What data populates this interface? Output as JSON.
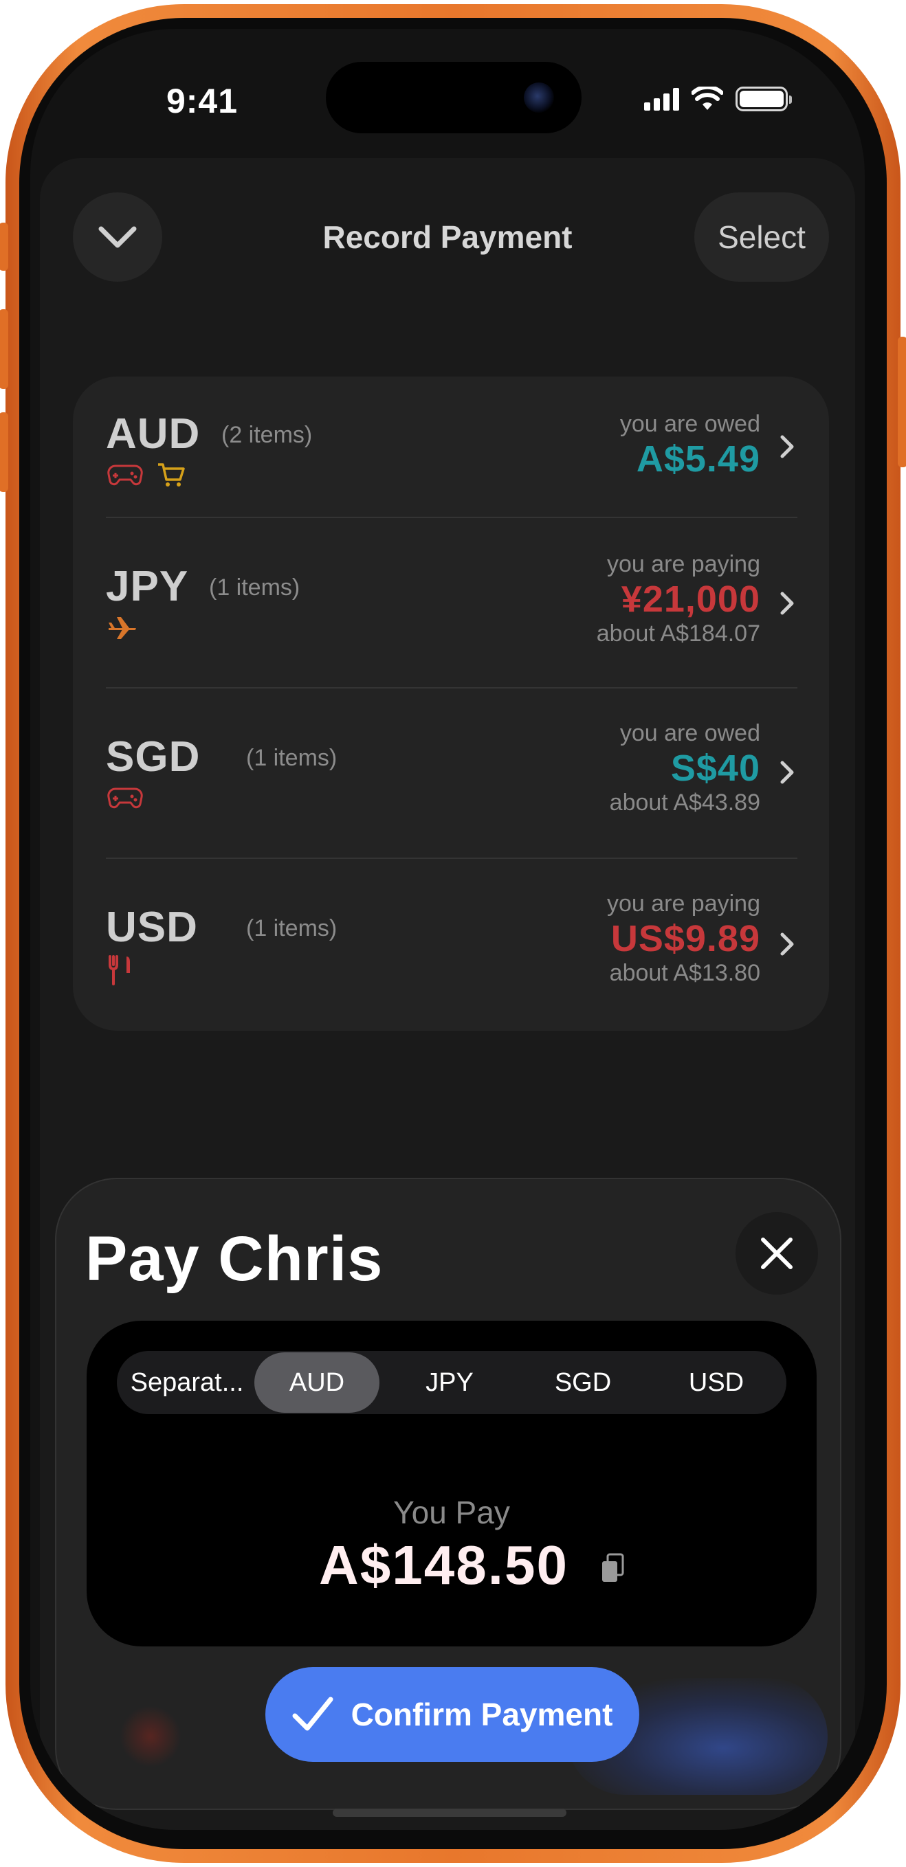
{
  "status_bar": {
    "time": "9:41"
  },
  "header": {
    "title": "Record Payment",
    "select_label": "Select"
  },
  "currencies": [
    {
      "code": "AUD",
      "count": "(2 items)",
      "status": "you are owed",
      "amount": "A$5.49",
      "about": "",
      "type": "owed",
      "icons": [
        "gamepad-icon",
        "cart-icon"
      ]
    },
    {
      "code": "JPY",
      "count": "(1 items)",
      "status": "you are paying",
      "amount": "¥21,000",
      "about": "about A$184.07",
      "type": "paying",
      "icons": [
        "airplane-icon"
      ]
    },
    {
      "code": "SGD",
      "count": "(1 items)",
      "status": "you are owed",
      "amount": "S$40",
      "about": "about A$43.89",
      "type": "owed",
      "icons": [
        "gamepad-icon"
      ]
    },
    {
      "code": "USD",
      "count": "(1 items)",
      "status": "you are paying",
      "amount": "US$9.89",
      "about": "about A$13.80",
      "type": "paying",
      "icons": [
        "fork-knife-icon"
      ]
    }
  ],
  "pay": {
    "title": "Pay Chris",
    "tabs": [
      "Separat...",
      "AUD",
      "JPY",
      "SGD",
      "USD"
    ],
    "selected_tab": "AUD",
    "you_pay_label": "You Pay",
    "amount": "A$148.50",
    "confirm_label": "Confirm Payment"
  },
  "colors": {
    "owed": "#1f9ba3",
    "paying": "#c7383b",
    "accent": "#4a7cf0",
    "frame": "#e8772c"
  }
}
